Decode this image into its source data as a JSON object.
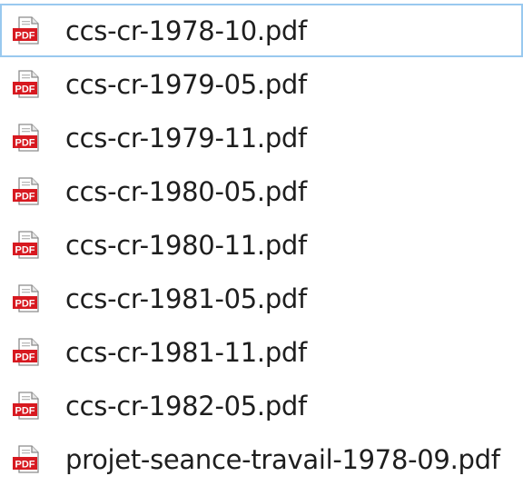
{
  "window": {
    "view": "file-list"
  },
  "files": [
    {
      "name": "ccs-cr-1978-10.pdf",
      "icon": "pdf-file-icon",
      "icon_label": "PDF",
      "selected": true
    },
    {
      "name": "ccs-cr-1979-05.pdf",
      "icon": "pdf-file-icon",
      "icon_label": "PDF",
      "selected": false
    },
    {
      "name": "ccs-cr-1979-11.pdf",
      "icon": "pdf-file-icon",
      "icon_label": "PDF",
      "selected": false
    },
    {
      "name": "ccs-cr-1980-05.pdf",
      "icon": "pdf-file-icon",
      "icon_label": "PDF",
      "selected": false
    },
    {
      "name": "ccs-cr-1980-11.pdf",
      "icon": "pdf-file-icon",
      "icon_label": "PDF",
      "selected": false
    },
    {
      "name": "ccs-cr-1981-05.pdf",
      "icon": "pdf-file-icon",
      "icon_label": "PDF",
      "selected": false
    },
    {
      "name": "ccs-cr-1981-11.pdf",
      "icon": "pdf-file-icon",
      "icon_label": "PDF",
      "selected": false
    },
    {
      "name": "ccs-cr-1982-05.pdf",
      "icon": "pdf-file-icon",
      "icon_label": "PDF",
      "selected": false
    },
    {
      "name": "projet-seance-travail-1978-09.pdf",
      "icon": "pdf-file-icon",
      "icon_label": "PDF",
      "selected": false
    }
  ],
  "colors": {
    "selection_border": "#99c9ef",
    "pdf_red": "#d71920",
    "text": "#1e1e1e"
  }
}
